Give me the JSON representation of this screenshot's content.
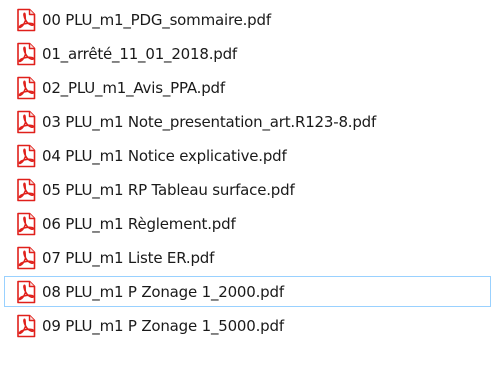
{
  "file_list": {
    "icon": "pdf-file-icon",
    "accent_color": "#e0201b",
    "selection_border_color": "#99d1ff",
    "selected_index": 8,
    "items": [
      {
        "name": "00 PLU_m1_PDG_sommaire.pdf"
      },
      {
        "name": "01_arrêté_11_01_2018.pdf"
      },
      {
        "name": "02_PLU_m1_Avis_PPA.pdf"
      },
      {
        "name": "03 PLU_m1 Note_presentation_art.R123-8.pdf"
      },
      {
        "name": "04 PLU_m1 Notice explicative.pdf"
      },
      {
        "name": "05 PLU_m1 RP Tableau surface.pdf"
      },
      {
        "name": "06 PLU_m1 Règlement.pdf"
      },
      {
        "name": "07 PLU_m1 Liste ER.pdf"
      },
      {
        "name": "08 PLU_m1 P Zonage 1_2000.pdf"
      },
      {
        "name": "09 PLU_m1 P Zonage 1_5000.pdf"
      }
    ]
  }
}
